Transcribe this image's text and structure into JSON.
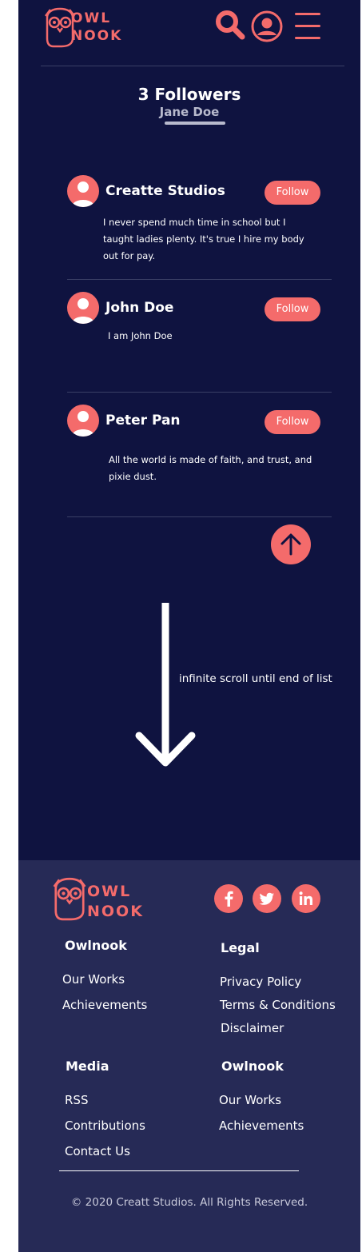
{
  "colors": {
    "background": "#0f1340",
    "footer": "#262a56",
    "accent": "#f46b6b",
    "text": "#ffffff"
  },
  "header": {
    "logo_line1": "OWL",
    "logo_line2": "NOOK",
    "icons": [
      "search-icon",
      "user-account-icon",
      "menu-icon"
    ]
  },
  "page": {
    "title": "3 Followers",
    "subtitle": "Jane Doe"
  },
  "followers": [
    {
      "name": "Creatte Studios",
      "button": "Follow",
      "bio": "I never spend much time in school but I taught ladies plenty. It's true I hire my body out for pay."
    },
    {
      "name": "John Doe",
      "button": "Follow",
      "bio": "I am John Doe"
    },
    {
      "name": "Peter Pan",
      "button": "Follow",
      "bio": "All the world is made of faith, and trust, and pixie dust."
    }
  ],
  "scroll_note": "infinite scroll until end of list",
  "footer": {
    "logo_line1": "OWL",
    "logo_line2": "NOOK",
    "social": [
      "facebook-icon",
      "twitter-icon",
      "linkedin-icon"
    ],
    "columns": [
      {
        "heading": "Owlnook",
        "links": [
          "Our Works",
          "Achievements"
        ]
      },
      {
        "heading": "Legal",
        "links": [
          "Privacy Policy",
          "Terms & Conditions",
          "Disclaimer"
        ]
      },
      {
        "heading": "Media",
        "links": [
          "RSS",
          "Contributions",
          "Contact Us"
        ]
      },
      {
        "heading": "Owlnook",
        "links": [
          "Our Works",
          "Achievements"
        ]
      }
    ],
    "copyright": "© 2020 Creatt Studios. All Rights Reserved."
  }
}
